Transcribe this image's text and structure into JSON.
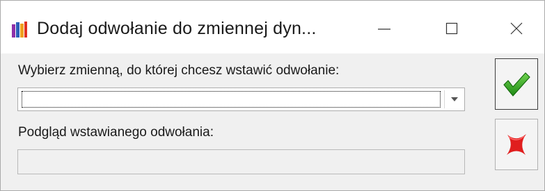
{
  "window": {
    "title": "Dodaj odwołanie do zmiennej dyn..."
  },
  "form": {
    "variable_label": "Wybierz zmienną, do której chcesz wstawić odwołanie:",
    "variable_value": "",
    "preview_label": "Podgląd wstawianego odwołania:",
    "preview_value": ""
  },
  "icons": {
    "app": "app-icon",
    "minimize": "minimize-icon",
    "maximize": "maximize-icon",
    "close": "close-icon",
    "dropdown": "chevron-down-icon",
    "ok": "checkmark-icon",
    "cancel": "cross-icon"
  },
  "colors": {
    "ok_green": "#2ea31f",
    "cancel_red": "#e01e1e"
  }
}
